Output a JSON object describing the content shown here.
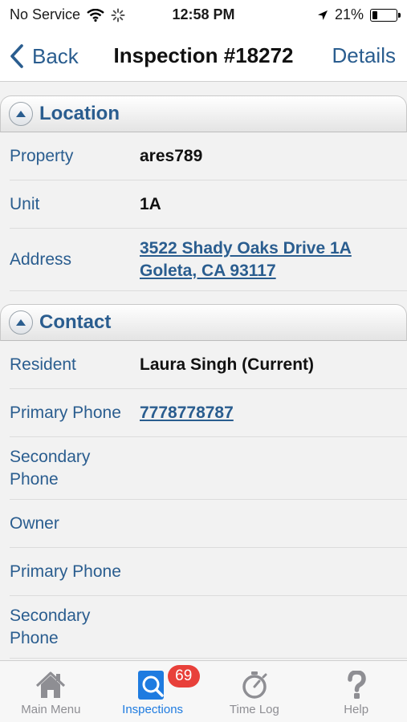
{
  "status_bar": {
    "carrier": "No Service",
    "time": "12:58 PM",
    "battery_percent": "21%",
    "battery_level": 0.21
  },
  "nav": {
    "back_label": "Back",
    "title": "Inspection #18272",
    "details_label": "Details"
  },
  "location": {
    "header": "Location",
    "property_label": "Property",
    "property_value": "ares789",
    "unit_label": "Unit",
    "unit_value": "1A",
    "address_label": "Address",
    "address_line1": "3522 Shady Oaks Drive 1A",
    "address_line2": "Goleta, CA 93117"
  },
  "contact": {
    "header": "Contact",
    "resident_label": "Resident",
    "resident_value": "Laura Singh (Current)",
    "primary_phone_label": "Primary Phone",
    "primary_phone_value": "7778778787",
    "secondary_phone_label_1": "Secondary",
    "secondary_phone_label_2": "Phone",
    "owner_label": "Owner",
    "owner_primary_phone_label": "Primary Phone",
    "owner_secondary_phone_label_1": "Secondary",
    "owner_secondary_phone_label_2": "Phone"
  },
  "tab_bar": {
    "main_menu": "Main Menu",
    "inspections": "Inspections",
    "inspections_badge": "69",
    "time_log": "Time Log",
    "help": "Help"
  },
  "colors": {
    "accent": "#2a5d8f",
    "tab_active": "#1e7be0",
    "badge": "#e8403a"
  }
}
